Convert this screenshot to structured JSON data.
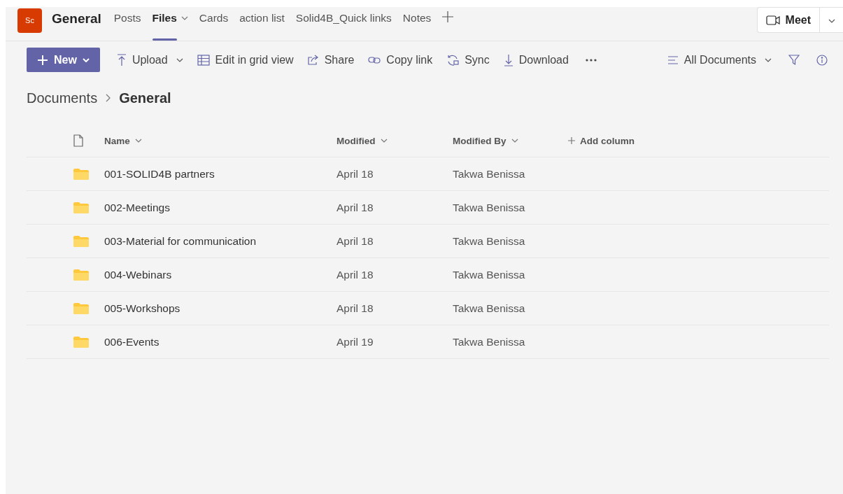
{
  "team": {
    "avatar": "Sc",
    "name": "General"
  },
  "tabs": [
    {
      "label": "Posts",
      "selected": false,
      "has_menu": false
    },
    {
      "label": "Files",
      "selected": true,
      "has_menu": true
    },
    {
      "label": "Cards",
      "selected": false,
      "has_menu": false
    },
    {
      "label": "action list",
      "selected": false,
      "has_menu": false
    },
    {
      "label": "Solid4B_Quick links",
      "selected": false,
      "has_menu": false
    },
    {
      "label": "Notes",
      "selected": false,
      "has_menu": false
    }
  ],
  "meet": {
    "label": "Meet"
  },
  "toolbar": {
    "new_label": "New",
    "actions": [
      {
        "kind": "upload",
        "label": "Upload",
        "has_menu": true
      },
      {
        "kind": "grid",
        "label": "Edit in grid view",
        "has_menu": false
      },
      {
        "kind": "share",
        "label": "Share",
        "has_menu": false
      },
      {
        "kind": "link",
        "label": "Copy link",
        "has_menu": false
      },
      {
        "kind": "sync",
        "label": "Sync",
        "has_menu": false
      },
      {
        "kind": "download",
        "label": "Download",
        "has_menu": false
      }
    ],
    "view": "All Documents"
  },
  "breadcrumb": [
    "Documents",
    "General"
  ],
  "table": {
    "columns": [
      "Name",
      "Modified",
      "Modified By"
    ],
    "add_column": "Add column",
    "rows": [
      {
        "name": "001-SOLID4B partners",
        "modified": "April 18",
        "modified_by": "Takwa Benissa"
      },
      {
        "name": "002-Meetings",
        "modified": "April 18",
        "modified_by": "Takwa Benissa"
      },
      {
        "name": "003-Material for communication",
        "modified": "April 18",
        "modified_by": "Takwa Benissa"
      },
      {
        "name": "004-Webinars",
        "modified": "April 18",
        "modified_by": "Takwa Benissa"
      },
      {
        "name": "005-Workshops",
        "modified": "April 18",
        "modified_by": "Takwa Benissa"
      },
      {
        "name": "006-Events",
        "modified": "April 19",
        "modified_by": "Takwa Benissa"
      }
    ]
  }
}
